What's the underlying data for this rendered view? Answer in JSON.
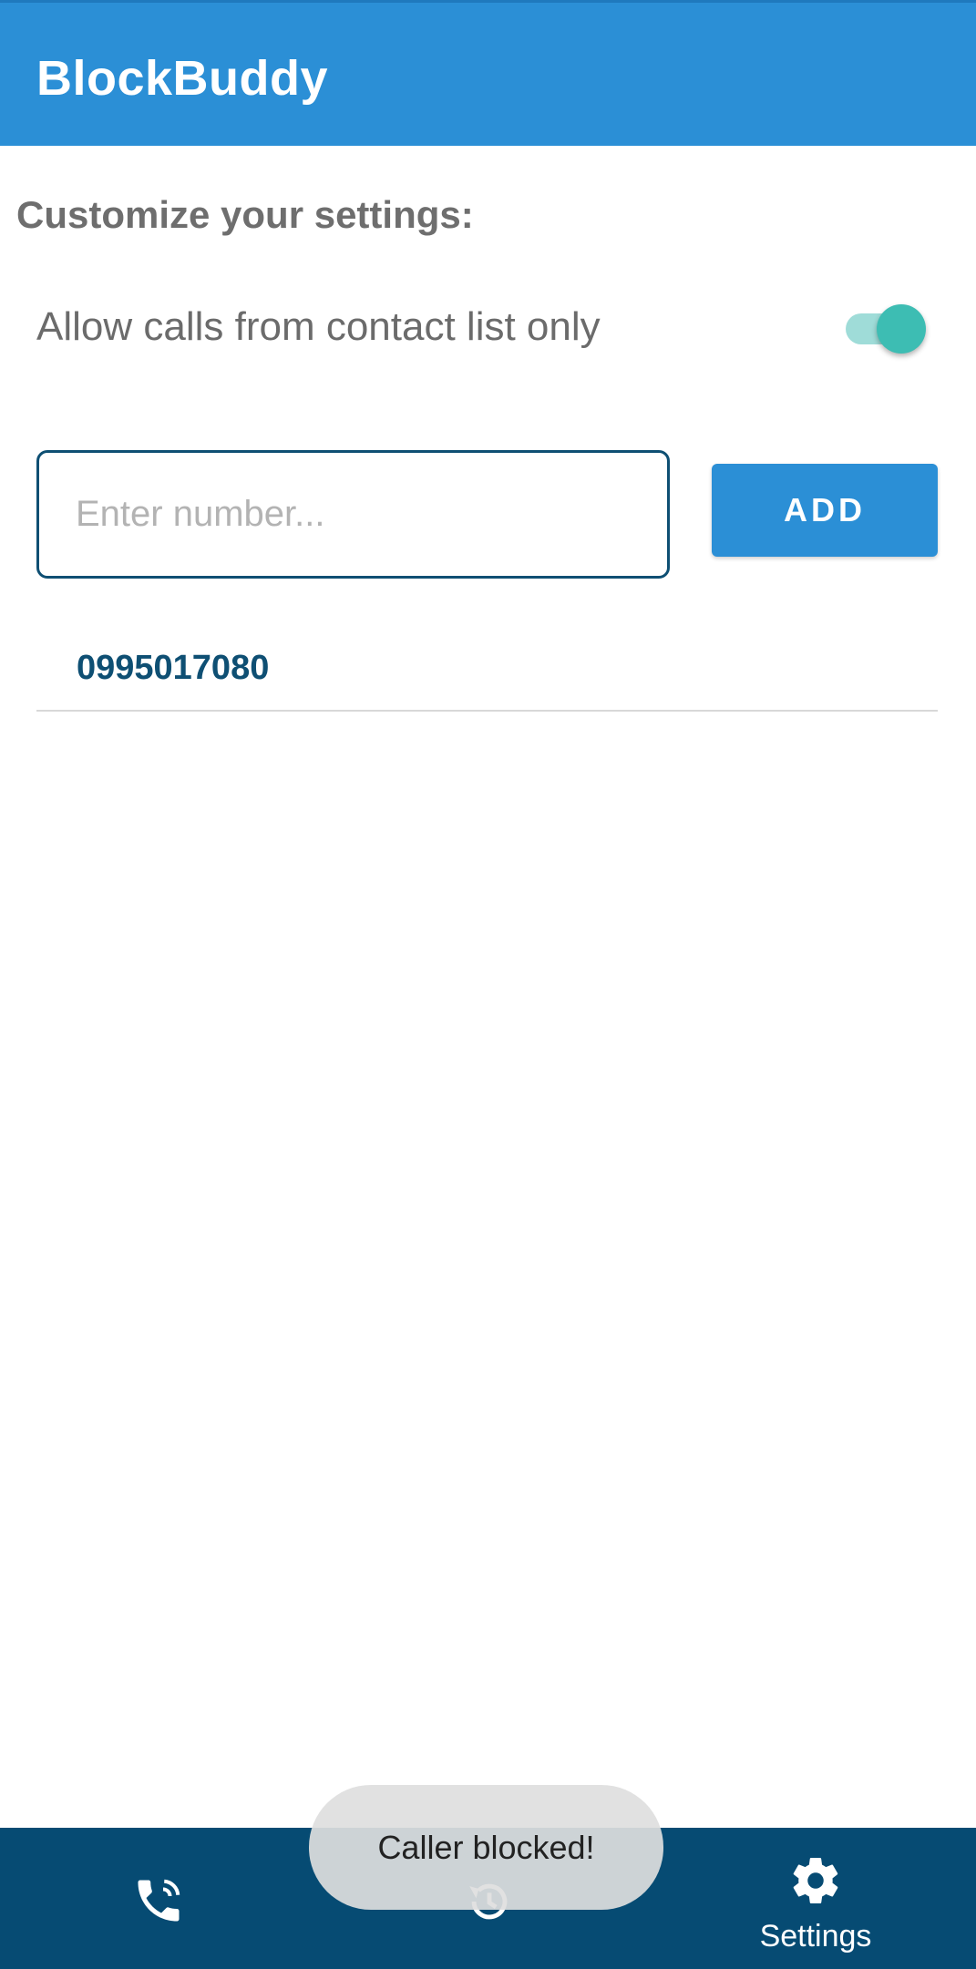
{
  "app": {
    "title": "BlockBuddy",
    "accent_color": "#2b8fd6",
    "nav_color": "#064b73"
  },
  "settings": {
    "heading": "Customize your settings:",
    "allow_contacts_only": {
      "label": "Allow calls from contact list only",
      "enabled": true
    },
    "number_input": {
      "placeholder": "Enter number...",
      "value": ""
    },
    "add_button_label": "ADD"
  },
  "blocked_numbers": [
    "0995017080"
  ],
  "bottom_nav": {
    "items": [
      {
        "icon": "phone-icon",
        "label": ""
      },
      {
        "icon": "history-icon",
        "label": ""
      },
      {
        "icon": "gear-icon",
        "label": "Settings",
        "selected": true
      }
    ]
  },
  "toast": {
    "message": "Caller blocked!"
  }
}
